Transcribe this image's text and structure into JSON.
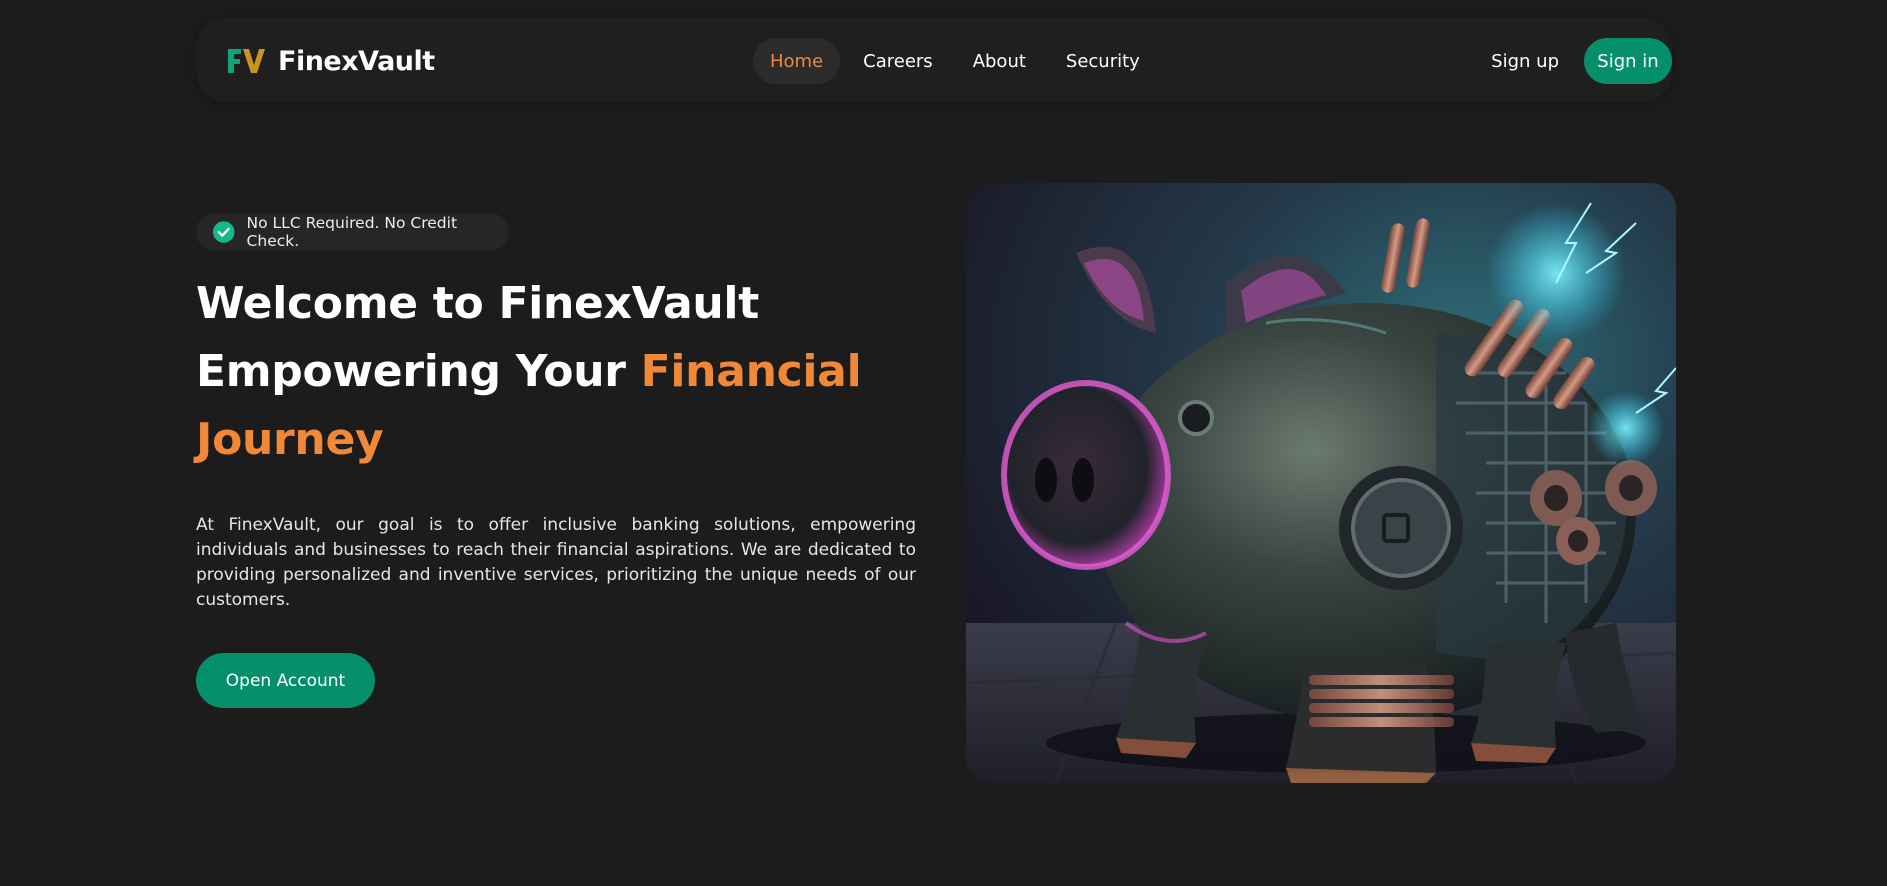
{
  "brand": {
    "logo_icon": "fv-monogram-icon",
    "name": "FinexVault",
    "colors": {
      "green": "#10a37a",
      "gold": "#c9951f"
    }
  },
  "nav": {
    "items": [
      {
        "label": "Home",
        "active": true
      },
      {
        "label": "Careers",
        "active": false
      },
      {
        "label": "About",
        "active": false
      },
      {
        "label": "Security",
        "active": false
      }
    ],
    "signup_label": "Sign up",
    "signin_label": "Sign in"
  },
  "hero": {
    "badge": {
      "icon": "check-circle-icon",
      "text": "No LLC Required. No Credit Check."
    },
    "headline": {
      "line1": "Welcome to FinexVault",
      "line2_prefix": "Empowering Your ",
      "line2_accent": "Financial",
      "line3_accent": "Journey"
    },
    "description": "At FinexVault, our goal is to offer inclusive banking solutions, empowering individuals and businesses to reach their financial aspirations. We are dedicated to providing personalized and inventive services, prioritizing the unique needs of our customers.",
    "cta_label": "Open Account",
    "image": {
      "subject": "cyberpunk-piggy-bank-image"
    }
  },
  "theme": {
    "background": "#1c1c1c",
    "accent_orange": "#f0883a",
    "primary_green": "#05906b",
    "text": "#ffffff"
  }
}
